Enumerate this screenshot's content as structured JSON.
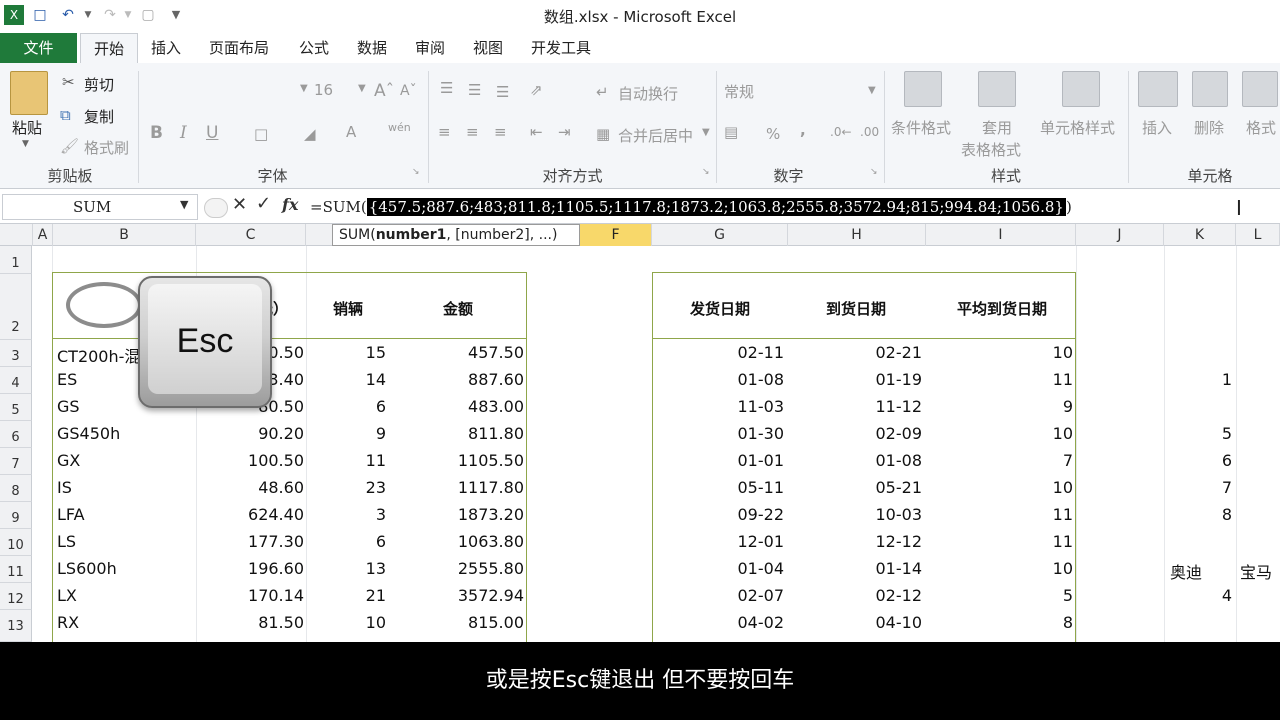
{
  "window": {
    "title": "数组.xlsx - Microsoft Excel"
  },
  "tabs": [
    "文件",
    "开始",
    "插入",
    "页面布局",
    "公式",
    "数据",
    "审阅",
    "视图",
    "开发工具"
  ],
  "ribbon": {
    "clipboard": {
      "paste": "粘贴",
      "cut": "剪切",
      "copy": "复制",
      "format_painter": "格式刷",
      "label": "剪贴板"
    },
    "font": {
      "size": "16",
      "bold": "B",
      "italic": "I",
      "underline": "U",
      "font_color": "A",
      "label": "字体"
    },
    "alignment": {
      "wrap": "自动换行",
      "merge": "合并后居中",
      "label": "对齐方式"
    },
    "number": {
      "format": "常规",
      "percent": "%",
      "comma": ",",
      "label": "数字"
    },
    "styles": {
      "conditional": "条件格式",
      "table_format_1": "套用",
      "table_format_2": "表格格式",
      "cell_style": "单元格样式",
      "label": "样式"
    },
    "cells": {
      "insert": "插入",
      "delete": "删除",
      "format": "格式",
      "label": "单元格"
    }
  },
  "formula_bar": {
    "name_box": "SUM",
    "formula_prefix": "=SUM(",
    "formula_selected": "{457.5;887.6;483;811.8;1105.5;1117.8;1873.2;1063.8;2555.8;3572.94;815;994.84;1056.8}",
    "formula_suffix": ")"
  },
  "tooltip": {
    "func": "SUM(",
    "arg1": "number1",
    "rest": ", [number2], ...)"
  },
  "columns": [
    "A",
    "B",
    "C",
    "F",
    "G",
    "H",
    "I",
    "J",
    "K",
    "L"
  ],
  "rows": [
    "1",
    "2",
    "3",
    "4",
    "5",
    "6",
    "7",
    "8",
    "9",
    "10",
    "11",
    "12",
    "13"
  ],
  "table1": {
    "headers": {
      "price": "元）",
      "qty": "销辆",
      "amount": "金额"
    },
    "rows": [
      {
        "model": "CT200h-混",
        "price": "0.50",
        "qty": "15",
        "amount": "457.50"
      },
      {
        "model": "ES",
        "price": "3.40",
        "qty": "14",
        "amount": "887.60"
      },
      {
        "model": "GS",
        "price": "80.50",
        "qty": "6",
        "amount": "483.00"
      },
      {
        "model": "GS450h",
        "price": "90.20",
        "qty": "9",
        "amount": "811.80"
      },
      {
        "model": "GX",
        "price": "100.50",
        "qty": "11",
        "amount": "1105.50"
      },
      {
        "model": "IS",
        "price": "48.60",
        "qty": "23",
        "amount": "1117.80"
      },
      {
        "model": "LFA",
        "price": "624.40",
        "qty": "3",
        "amount": "1873.20"
      },
      {
        "model": "LS",
        "price": "177.30",
        "qty": "6",
        "amount": "1063.80"
      },
      {
        "model": "LS600h",
        "price": "196.60",
        "qty": "13",
        "amount": "2555.80"
      },
      {
        "model": "LX",
        "price": "170.14",
        "qty": "21",
        "amount": "3572.94"
      },
      {
        "model": "RX",
        "price": "81.50",
        "qty": "10",
        "amount": "815.00"
      }
    ]
  },
  "table2": {
    "headers": {
      "ship": "发货日期",
      "arrive": "到货日期",
      "avg": "平均到货日期"
    },
    "rows": [
      {
        "ship": "02-11",
        "arrive": "02-21",
        "avg": "10"
      },
      {
        "ship": "01-08",
        "arrive": "01-19",
        "avg": "11"
      },
      {
        "ship": "11-03",
        "arrive": "11-12",
        "avg": "9"
      },
      {
        "ship": "01-30",
        "arrive": "02-09",
        "avg": "10"
      },
      {
        "ship": "01-01",
        "arrive": "01-08",
        "avg": "7"
      },
      {
        "ship": "05-11",
        "arrive": "05-21",
        "avg": "10"
      },
      {
        "ship": "09-22",
        "arrive": "10-03",
        "avg": "11"
      },
      {
        "ship": "12-01",
        "arrive": "12-12",
        "avg": "11"
      },
      {
        "ship": "01-04",
        "arrive": "01-14",
        "avg": "10"
      },
      {
        "ship": "02-07",
        "arrive": "02-12",
        "avg": "5"
      },
      {
        "ship": "04-02",
        "arrive": "04-10",
        "avg": "8"
      }
    ]
  },
  "k_column": [
    {
      "row": "4",
      "value": "1"
    },
    {
      "row": "6",
      "value": "5"
    },
    {
      "row": "7",
      "value": "6"
    },
    {
      "row": "8",
      "value": "7"
    },
    {
      "row": "9",
      "value": "8"
    },
    {
      "row": "12",
      "value": "4"
    }
  ],
  "row11_labels": {
    "k": "奥迪",
    "l": "宝马"
  },
  "overlay": {
    "key": "Esc"
  },
  "subtitle": "或是按Esc键退出 但不要按回车",
  "colors": {
    "file_tab": "#1f7a3a",
    "selected_col": "#f8d86a",
    "table_border": "#8fa64a"
  }
}
